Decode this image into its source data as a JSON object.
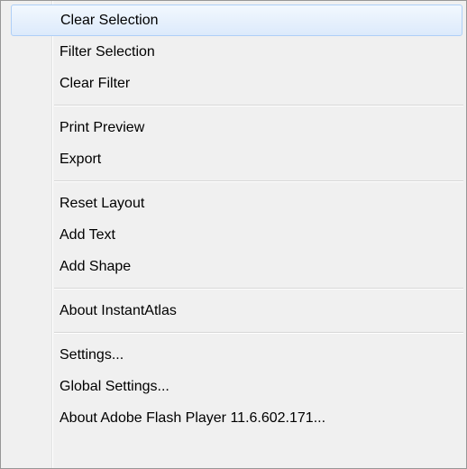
{
  "menu": {
    "groups": [
      {
        "items": [
          {
            "label": "Clear Selection"
          },
          {
            "label": "Filter Selection"
          },
          {
            "label": "Clear Filter"
          }
        ]
      },
      {
        "items": [
          {
            "label": "Print Preview"
          },
          {
            "label": "Export"
          }
        ]
      },
      {
        "items": [
          {
            "label": "Reset Layout"
          },
          {
            "label": "Add Text"
          },
          {
            "label": "Add Shape"
          }
        ]
      },
      {
        "items": [
          {
            "label": "About InstantAtlas"
          }
        ]
      },
      {
        "items": [
          {
            "label": "Settings..."
          },
          {
            "label": "Global Settings..."
          },
          {
            "label": "About Adobe Flash Player 11.6.602.171..."
          }
        ]
      }
    ],
    "highlighted_item": "Clear Selection",
    "colors": {
      "background": "#f0f0f0",
      "border": "#979797",
      "highlight_border": "#aecff7",
      "highlight_fill": "#dceafb"
    }
  }
}
